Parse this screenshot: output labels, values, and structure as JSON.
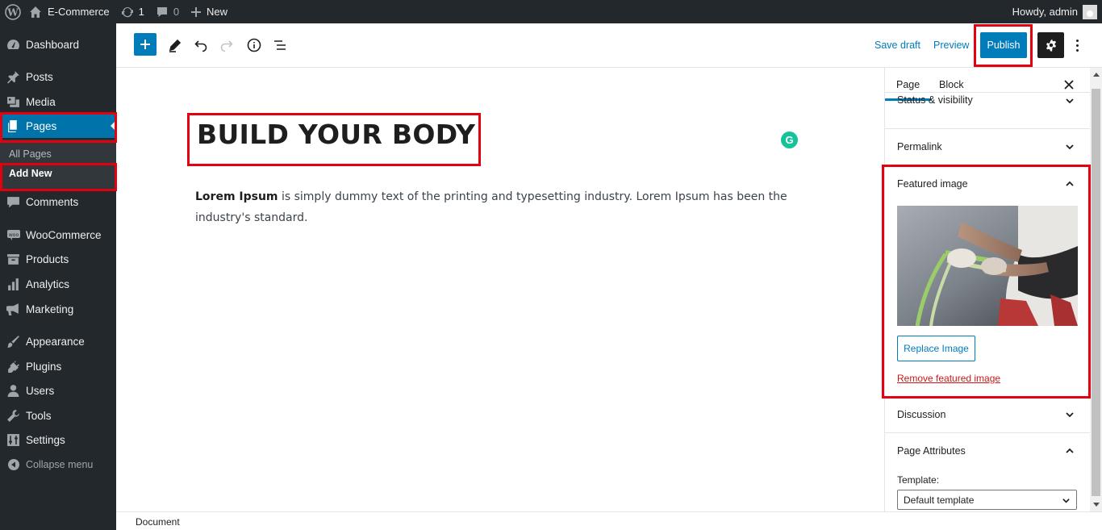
{
  "admin_bar": {
    "site_name": "E-Commerce",
    "updates_count": "1",
    "comments_count": "0",
    "new_label": "New",
    "greeting": "Howdy, admin"
  },
  "sidebar": {
    "items": [
      {
        "label": "Dashboard",
        "icon": "dashboard-icon"
      },
      {
        "label": "Posts",
        "icon": "pin-icon"
      },
      {
        "label": "Media",
        "icon": "media-icon"
      },
      {
        "label": "Pages",
        "icon": "pages-icon",
        "active": true
      },
      {
        "label": "Comments",
        "icon": "comment-icon"
      },
      {
        "label": "WooCommerce",
        "icon": "woocommerce-icon"
      },
      {
        "label": "Products",
        "icon": "archive-icon"
      },
      {
        "label": "Analytics",
        "icon": "bar-chart-icon"
      },
      {
        "label": "Marketing",
        "icon": "megaphone-icon"
      },
      {
        "label": "Appearance",
        "icon": "brush-icon"
      },
      {
        "label": "Plugins",
        "icon": "plug-icon"
      },
      {
        "label": "Users",
        "icon": "user-icon"
      },
      {
        "label": "Tools",
        "icon": "wrench-icon"
      },
      {
        "label": "Settings",
        "icon": "settings-icon"
      }
    ],
    "submenu": [
      {
        "label": "All Pages"
      },
      {
        "label": "Add New",
        "current": true
      }
    ],
    "collapse_label": "Collapse menu"
  },
  "toolbar": {
    "save_draft": "Save draft",
    "preview": "Preview",
    "publish": "Publish"
  },
  "editor": {
    "title": "BUILD YOUR BODY",
    "paragraph_bold": "Lorem Ipsum",
    "paragraph_rest": " is simply dummy text of the printing and typesetting industry. Lorem Ipsum has been the industry's standard.",
    "grammarly_letter": "G"
  },
  "settings": {
    "tabs": [
      "Page",
      "Block"
    ],
    "panels": {
      "status": "Status & visibility",
      "permalink": "Permalink",
      "featured": "Featured image",
      "discussion": "Discussion",
      "attributes": "Page Attributes"
    },
    "replace_image": "Replace Image",
    "remove_image": "Remove featured image",
    "template_label": "Template:",
    "template_value": "Default template"
  },
  "footer": {
    "breadcrumb": "Document"
  },
  "colors": {
    "wp_dark": "#23282d",
    "accent": "#007cba",
    "highlight": "#e3000f"
  }
}
